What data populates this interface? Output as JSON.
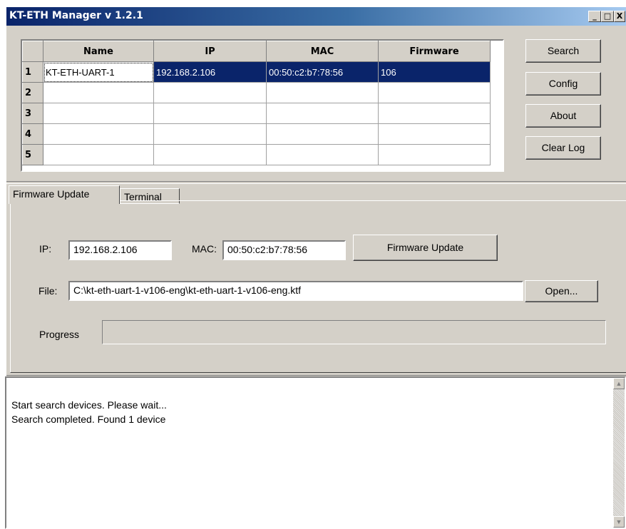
{
  "window": {
    "title": "KT-ETH Manager v 1.2.1",
    "controls": {
      "minimize": "_",
      "maximize": "□",
      "close": "X"
    }
  },
  "grid": {
    "columns": [
      "Name",
      "IP",
      "MAC",
      "Firmware"
    ],
    "rows": [
      {
        "num": "1",
        "name": "KT-ETH-UART-1",
        "ip": "192.168.2.106",
        "mac": "00:50:c2:b7:78:56",
        "firmware": "106"
      },
      {
        "num": "2",
        "name": "",
        "ip": "",
        "mac": "",
        "firmware": ""
      },
      {
        "num": "3",
        "name": "",
        "ip": "",
        "mac": "",
        "firmware": ""
      },
      {
        "num": "4",
        "name": "",
        "ip": "",
        "mac": "",
        "firmware": ""
      },
      {
        "num": "5",
        "name": "",
        "ip": "",
        "mac": "",
        "firmware": ""
      }
    ],
    "selected_row": 1
  },
  "side_buttons": {
    "search": "Search",
    "config": "Config",
    "about": "About",
    "clear_log": "Clear Log"
  },
  "tabs": [
    {
      "label": "Firmware Update",
      "active": true
    },
    {
      "label": "Terminal",
      "active": false
    }
  ],
  "firmware": {
    "ip_label": "IP:",
    "ip_value": "192.168.2.106",
    "mac_label": "MAC:",
    "mac_value": "00:50:c2:b7:78:56",
    "update_button": "Firmware Update",
    "file_label": "File:",
    "file_value": "C:\\kt-eth-uart-1-v106-eng\\kt-eth-uart-1-v106-eng.ktf",
    "open_button": "Open...",
    "progress_label": "Progress",
    "progress_fraction": 0
  },
  "log": {
    "lines": [
      "Start search devices. Please wait...",
      "Search completed. Found 1 device"
    ]
  },
  "colors": {
    "face": "#d4d0c8",
    "selection": "#0a246a",
    "title_gradient_start": "#0a246a",
    "title_gradient_end": "#a6caf0"
  }
}
